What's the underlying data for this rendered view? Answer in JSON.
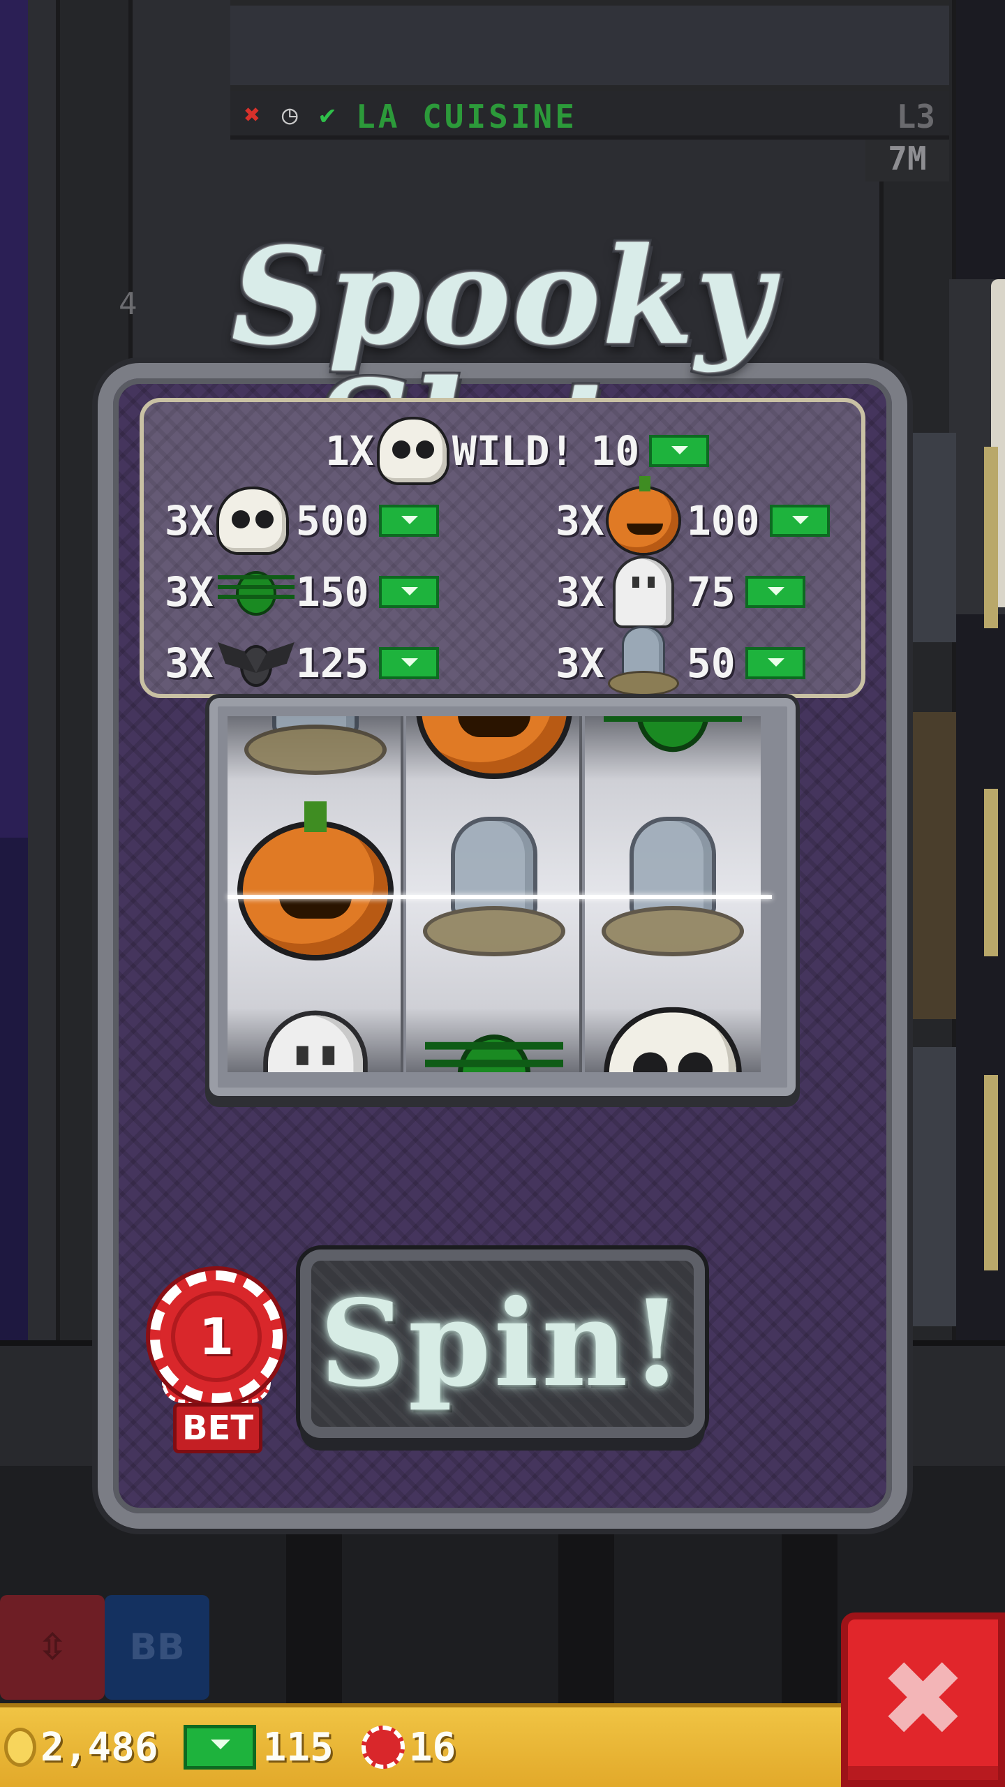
{
  "background": {
    "floor_sign": {
      "name": "LA CUISINE",
      "level": "L3",
      "x_icon": "✖",
      "clock_icon": "◷",
      "check_icon": "✔"
    },
    "floor_price": "7M",
    "floor_number": "4",
    "elevator": {
      "updown_glyph": "⇳",
      "bb_label": "BB"
    }
  },
  "slot_machine": {
    "title": "Spooky Slots",
    "paytable": {
      "wild": {
        "multiplier": "1X",
        "symbol": "skull",
        "label": "WILD!",
        "payout": "10"
      },
      "rows": [
        {
          "multiplier": "3X",
          "symbol": "skull",
          "payout": "500"
        },
        {
          "multiplier": "3X",
          "symbol": "pumpkin",
          "payout": "100"
        },
        {
          "multiplier": "3X",
          "symbol": "spider",
          "payout": "150"
        },
        {
          "multiplier": "3X",
          "symbol": "ghost",
          "payout": "75"
        },
        {
          "multiplier": "3X",
          "symbol": "bat",
          "payout": "125"
        },
        {
          "multiplier": "3X",
          "symbol": "tombstone",
          "payout": "50"
        }
      ]
    },
    "reels": [
      {
        "top": "tombstone",
        "middle": "pumpkin",
        "bottom": "ghost"
      },
      {
        "top": "pumpkin",
        "middle": "tombstone",
        "bottom": "spider"
      },
      {
        "top": "spider",
        "middle": "tombstone",
        "bottom": "skull"
      }
    ],
    "bet": {
      "value": "1",
      "label": "BET"
    },
    "spin_label": "Spin!"
  },
  "status_bar": {
    "coins": "2,486",
    "bux": "115",
    "chips": "16"
  },
  "close_glyph": "✖",
  "colors": {
    "cash_green": "#1eb33d",
    "chip_red": "#d9272b",
    "status_gold": "#f0c444",
    "close_red": "#e1262b",
    "machine_purple": "#45355d"
  }
}
